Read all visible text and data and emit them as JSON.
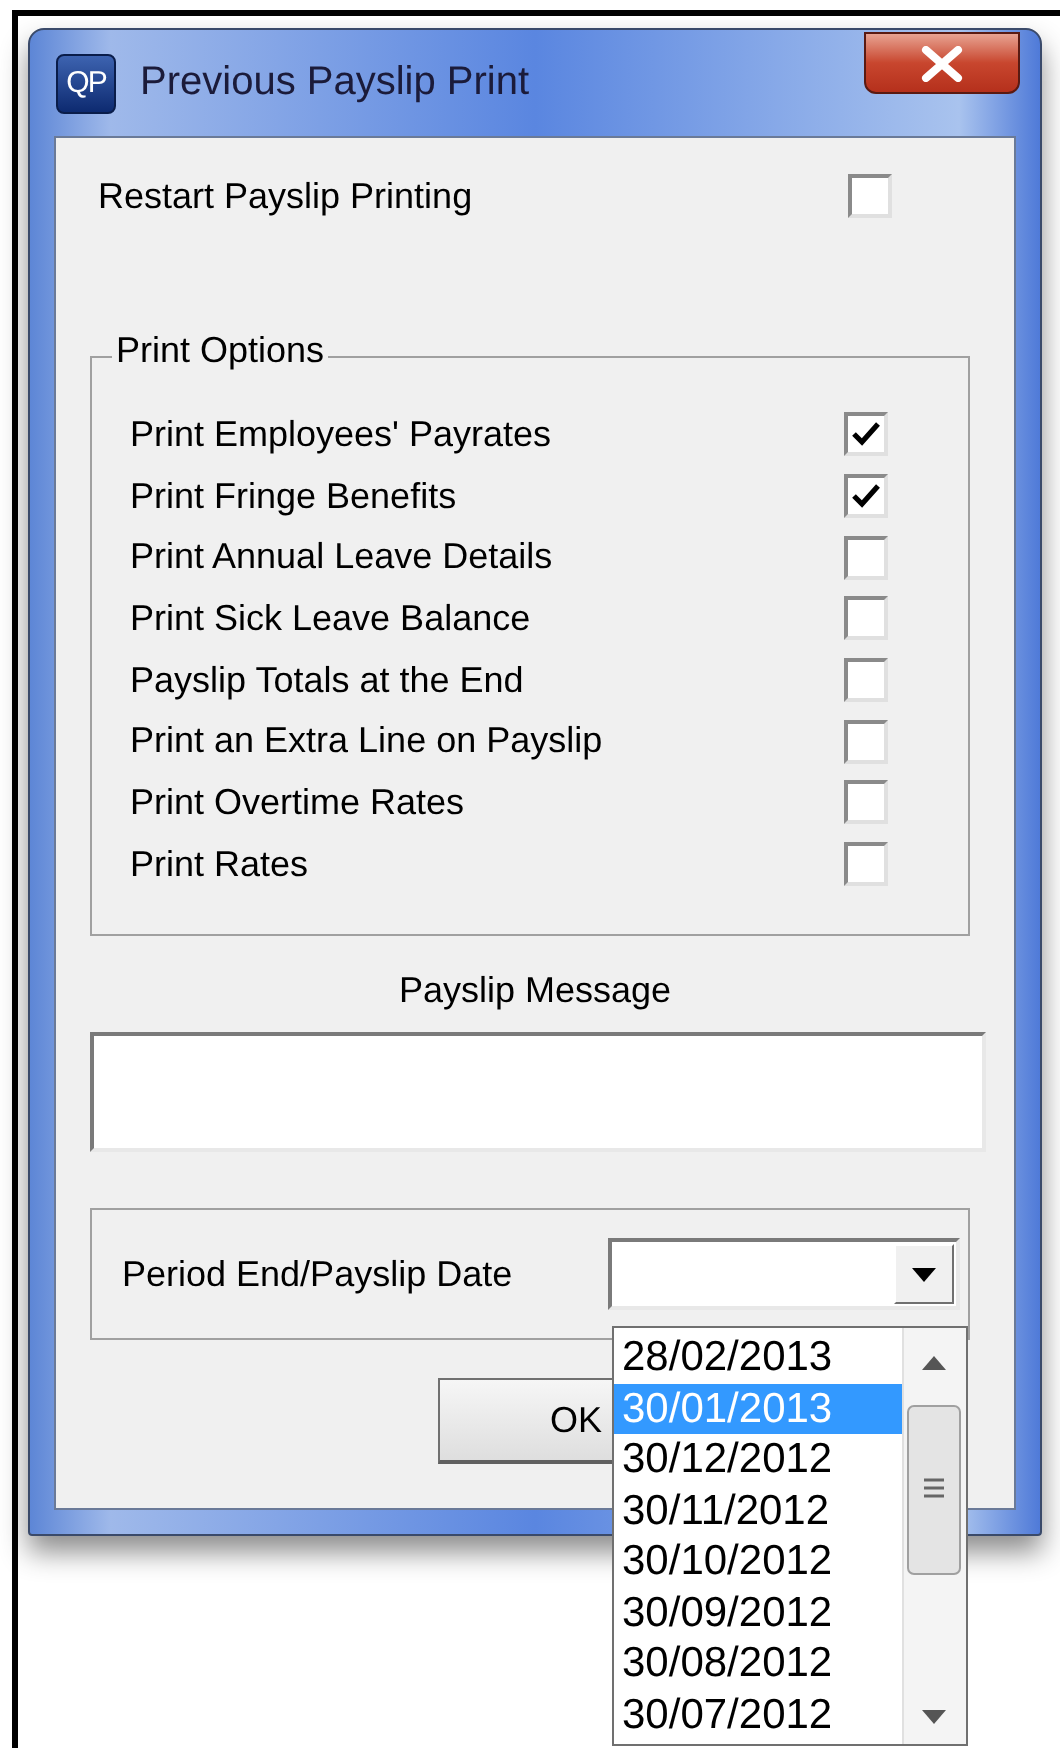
{
  "window": {
    "icon_label": "QP",
    "title": "Previous Payslip Print"
  },
  "restart": {
    "label": "Restart Payslip Printing",
    "checked": false
  },
  "print_options": {
    "legend": "Print Options",
    "options": [
      {
        "label": "Print Employees' Payrates",
        "checked": true
      },
      {
        "label": "Print Fringe Benefits",
        "checked": true
      },
      {
        "label": "Print Annual Leave Details",
        "checked": false
      },
      {
        "label": "Print Sick Leave Balance",
        "checked": false
      },
      {
        "label": "Payslip Totals at the End",
        "checked": false
      },
      {
        "label": "Print an Extra Line on Payslip",
        "checked": false
      },
      {
        "label": "Print Overtime Rates",
        "checked": false
      },
      {
        "label": "Print Rates",
        "checked": false
      }
    ]
  },
  "message": {
    "label": "Payslip Message"
  },
  "date": {
    "label": "Period End/Payslip Date",
    "expanded": true,
    "items": [
      {
        "label": "28/02/2013",
        "selected": false
      },
      {
        "label": "30/01/2013",
        "selected": true
      },
      {
        "label": "30/12/2012",
        "selected": false
      },
      {
        "label": "30/11/2012",
        "selected": false
      },
      {
        "label": "30/10/2012",
        "selected": false
      },
      {
        "label": "30/09/2012",
        "selected": false
      },
      {
        "label": "30/08/2012",
        "selected": false
      },
      {
        "label": "30/07/2012",
        "selected": false
      }
    ]
  },
  "buttons": [
    "OK"
  ]
}
